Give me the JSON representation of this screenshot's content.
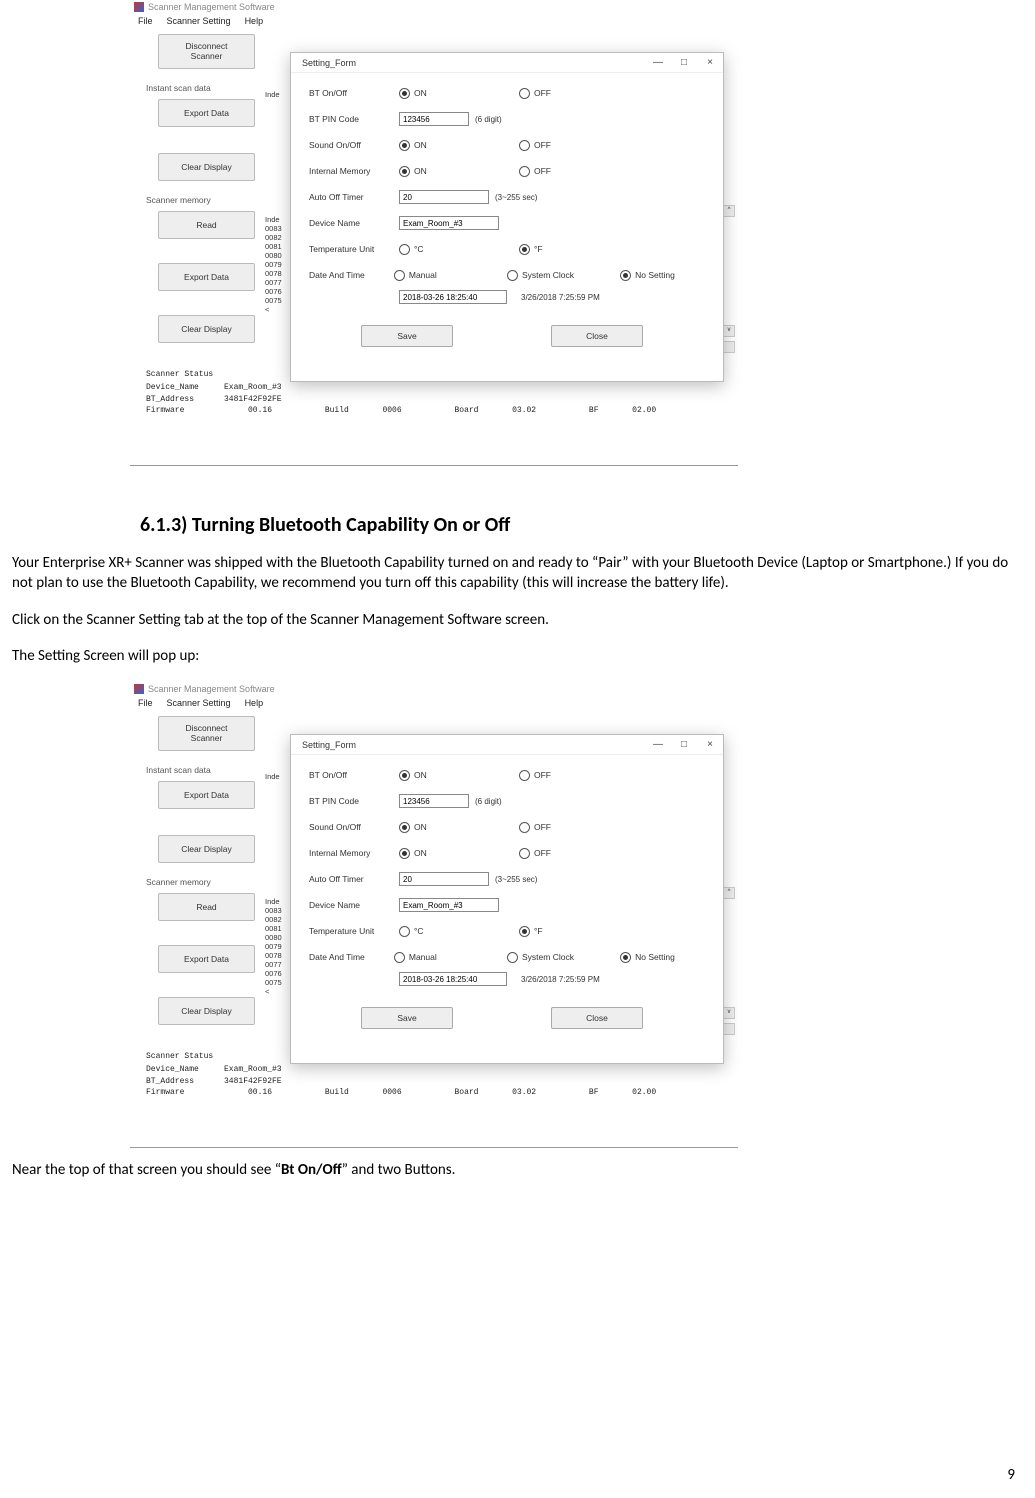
{
  "doc": {
    "heading": "6.1.3) Turning Bluetooth Capability On or Off",
    "para1": "Your Enterprise XR+ Scanner was shipped with the Bluetooth Capability turned on and ready to “Pair” with your Bluetooth Device (Laptop or Smartphone.)  If you do not plan to use the Bluetooth Capability, we recommend you turn off this capability (this will increase the battery life).",
    "para2": "Click on the Scanner Setting tab at the top of the Scanner Management Software screen.",
    "para3": "The Setting Screen will pop up:",
    "para4a": "Near the top of that screen you should see “",
    "para4b": "Bt On/Off",
    "para4c": "” and two Buttons.",
    "page_number": "9"
  },
  "parent": {
    "title": "Scanner Management Software",
    "menu": {
      "file": "File",
      "setting": "Scanner Setting",
      "help": "Help"
    },
    "side": {
      "disconnect1": "Disconnect",
      "disconnect2": "Scanner",
      "grp_scan": "Instant scan data",
      "export": "Export Data",
      "clear": "Clear Display",
      "grp_mem": "Scanner memory",
      "read": "Read",
      "export2": "Export Data",
      "clear2": "Clear Display"
    },
    "bg": {
      "inde": "Inde",
      "mem": [
        "Inde",
        "0083",
        "0082",
        "0081",
        "0080",
        "0079",
        "0078",
        "0077",
        "0076",
        "0075"
      ],
      "mem_left_arrow": "<"
    },
    "status": {
      "title": "Scanner Status",
      "dev_l": "Device_Name",
      "dev_v": "Exam_Room_#3",
      "bt_l": "BT_Address",
      "bt_v": "3481F42F92FE",
      "fw_l": "Firmware",
      "fw_v": "00.16",
      "build_l": "Build",
      "build_v": "0006",
      "board_l": "Board",
      "board_v": "03.02",
      "bf_l": "BF",
      "bf_v": "02.00"
    }
  },
  "dlg": {
    "title": "Setting_Form",
    "rows": {
      "bt": "BT On/Off",
      "pin": "BT PIN Code",
      "sound": "Sound On/Off",
      "mem": "Internal Memory",
      "timer": "Auto Off Timer",
      "devname": "Device Name",
      "tunit": "Temperature Unit",
      "dtime": "Date And Time"
    },
    "opts": {
      "on": "ON",
      "off": "OFF",
      "c": "°C",
      "f": "°F",
      "manual": "Manual",
      "sysclock": "System Clock",
      "nosetting": "No Setting"
    },
    "vals": {
      "pin": "123456",
      "pin_hint": "(6 digit)",
      "timer": "20",
      "timer_hint": "(3~255 sec)",
      "devname": "Exam_Room_#3",
      "manual_dt": "2018-03-26 18:25:40",
      "sys_dt": "3/26/2018 7:25:59 PM"
    },
    "btns": {
      "save": "Save",
      "close": "Close"
    }
  }
}
